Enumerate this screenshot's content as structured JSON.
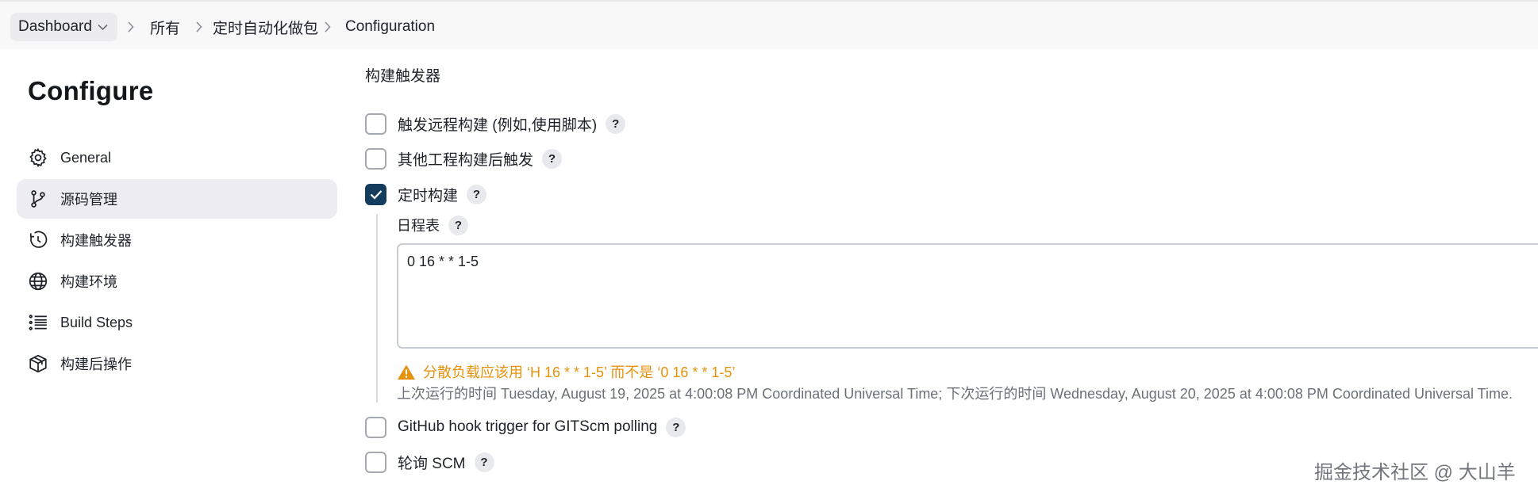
{
  "breadcrumb": {
    "dashboard": "Dashboard",
    "all": "所有",
    "job": "定时自动化做包",
    "current": "Configuration"
  },
  "sidebar": {
    "title": "Configure",
    "items": [
      {
        "label": "General",
        "icon": "gear-icon",
        "active": false
      },
      {
        "label": "源码管理",
        "icon": "branch-icon",
        "active": true
      },
      {
        "label": "构建触发器",
        "icon": "clock-icon",
        "active": false
      },
      {
        "label": "构建环境",
        "icon": "globe-icon",
        "active": false
      },
      {
        "label": "Build Steps",
        "icon": "list-icon",
        "active": false
      },
      {
        "label": "构建后操作",
        "icon": "box-icon",
        "active": false
      }
    ]
  },
  "triggers": {
    "section_title": "构建触发器",
    "options": [
      {
        "label": "触发远程构建 (例如,使用脚本)",
        "checked": false
      },
      {
        "label": "其他工程构建后触发",
        "checked": false
      },
      {
        "label": "定时构建",
        "checked": true
      },
      {
        "label": "GitHub hook trigger for GITScm polling",
        "checked": false
      },
      {
        "label": "轮询 SCM",
        "checked": false
      }
    ],
    "help_symbol": "?",
    "schedule": {
      "label": "日程表",
      "value": "0 16 * * 1-5",
      "warning": "分散负载应该用 ‘H 16 * * 1-5’ 而不是 ‘0 16 * * 1-5’",
      "next_run": "上次运行的时间 Tuesday, August 19, 2025 at 4:00:08 PM Coordinated Universal Time; 下次运行的时间 Wednesday, August 20, 2025 at 4:00:08 PM Coordinated Universal Time."
    }
  },
  "watermark": "掘金技术社区 @ 大山羊",
  "colors": {
    "checkbox_checked": "#143d5d",
    "warning": "#e8920c",
    "active_nav": "#ececf2"
  }
}
